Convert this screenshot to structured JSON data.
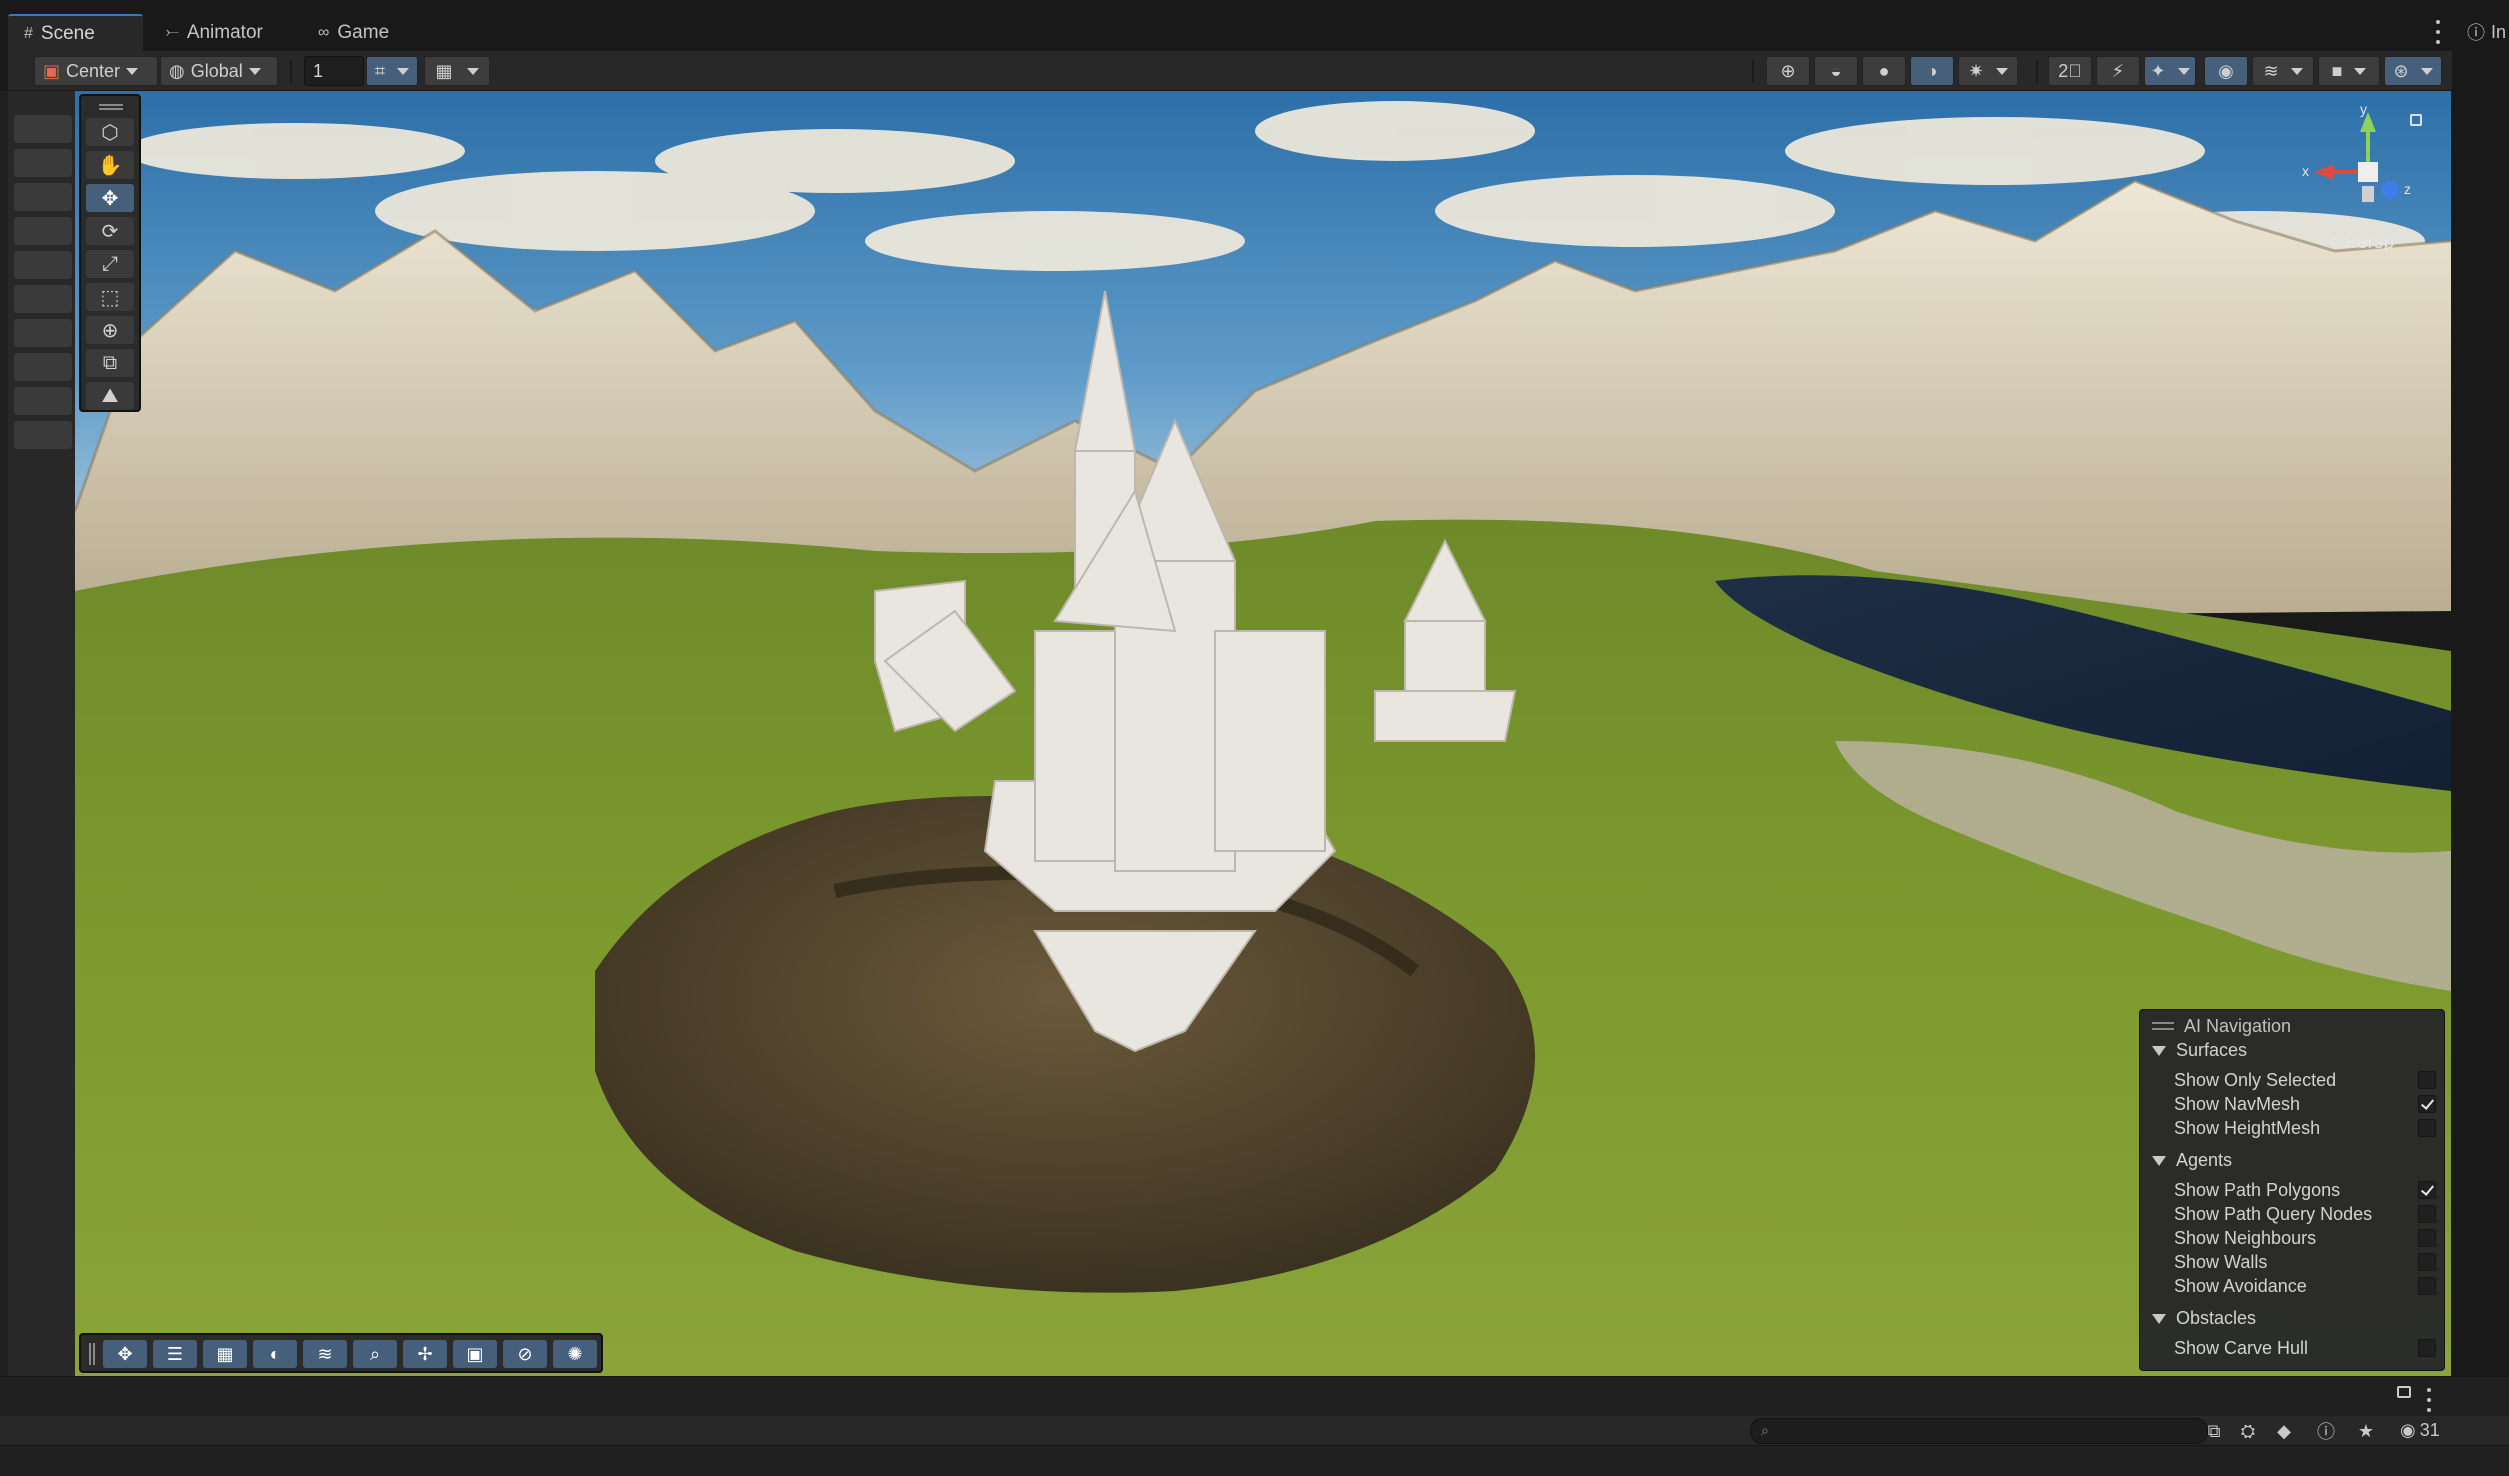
{
  "tabs": [
    {
      "label": "Scene",
      "icon": "grid-icon"
    },
    {
      "label": "Animator",
      "icon": "animator-icon"
    },
    {
      "label": "Game",
      "icon": "gamepad-icon"
    }
  ],
  "inspector_tab": {
    "label": "In",
    "icon": "info-icon"
  },
  "toolbar": {
    "pivot_label": "Center",
    "space_label": "Global",
    "snap_value": "1"
  },
  "gizmo": {
    "x_label": "x",
    "y_label": "y",
    "z_label": "z",
    "projection_label": "< Persp"
  },
  "ai_navigation": {
    "title": "AI Navigation",
    "sections": [
      {
        "title": "Surfaces",
        "items": [
          {
            "label": "Show Only Selected",
            "checked": false
          },
          {
            "label": "Show NavMesh",
            "checked": true
          },
          {
            "label": "Show HeightMesh",
            "checked": false
          }
        ]
      },
      {
        "title": "Agents",
        "items": [
          {
            "label": "Show Path Polygons",
            "checked": true
          },
          {
            "label": "Show Path Query Nodes",
            "checked": false
          },
          {
            "label": "Show Neighbours",
            "checked": false
          },
          {
            "label": "Show Walls",
            "checked": false
          },
          {
            "label": "Show Avoidance",
            "checked": false
          }
        ]
      },
      {
        "title": "Obstacles",
        "items": [
          {
            "label": "Show Carve Hull",
            "checked": false
          }
        ]
      }
    ]
  },
  "project_bar": {
    "search_placeholder": "",
    "hidden_count": "31"
  },
  "colors": {
    "accent": "#3a79bb",
    "active_button": "#46607c",
    "panel_bg": "#282828"
  }
}
